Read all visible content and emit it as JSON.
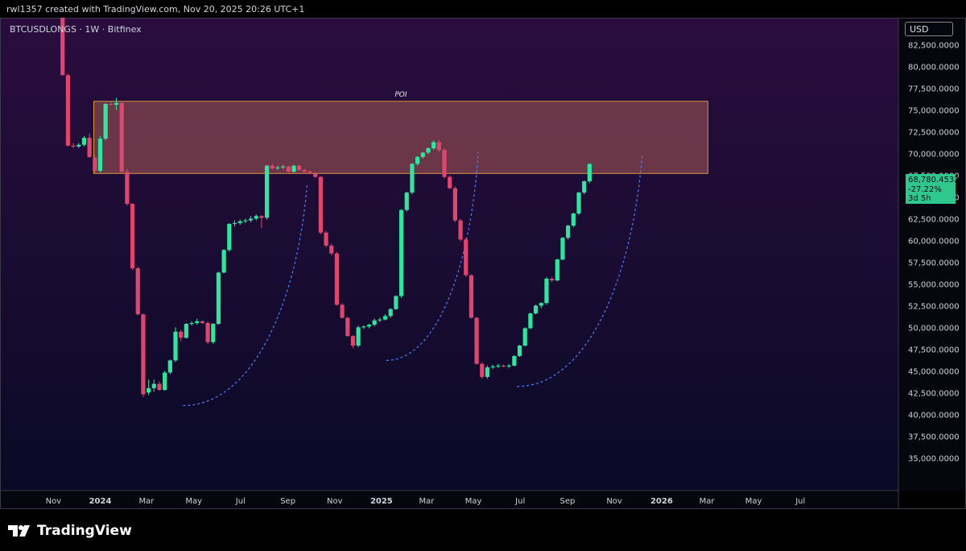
{
  "header": {
    "watermark": "rwl1357 created with TradingView.com, Nov 20, 2025 20:26 UTC+1"
  },
  "symbol": "BTCUSDLONGS · 1W · Bitfinex",
  "currency_button": "USD",
  "price_tag": {
    "price": "68,780.4532",
    "change": "-27.22%",
    "countdown": "3d 5h"
  },
  "footer": {
    "brand": "TradingView"
  },
  "chart_data": {
    "type": "candlestick",
    "y_ticks": [
      35000,
      37500,
      40000,
      42500,
      45000,
      47500,
      50000,
      52500,
      55000,
      57500,
      60000,
      62500,
      65000,
      67500,
      70000,
      72500,
      75000,
      77500,
      80000,
      82500
    ],
    "y_tick_labels": [
      "35,000.0000",
      "37,500.0000",
      "40,000.0000",
      "42,500.0000",
      "45,000.0000",
      "47,500.0000",
      "50,000.0000",
      "52,500.0000",
      "55,000.0000",
      "57,500.0000",
      "60,000.0000",
      "62,500.0000",
      "65,000.0000",
      "67,500.0000",
      "70,000.0000",
      "72,500.0000",
      "75,000.0000",
      "77,500.0000",
      "80,000.0000",
      "82,500.0000"
    ],
    "ylim": [
      32800,
      85800
    ],
    "x_labels": [
      "Nov",
      "2024",
      "Mar",
      "May",
      "Jul",
      "Sep",
      "Nov",
      "2025",
      "Mar",
      "May",
      "Jul",
      "Sep",
      "Nov",
      "2026",
      "Mar",
      "May",
      "Jul"
    ],
    "x_label_weeks": [
      -8.7,
      0,
      8.6,
      17.4,
      26.1,
      34.9,
      43.6,
      52.3,
      60.7,
      69.4,
      78.1,
      86.9,
      95.6,
      104.4,
      112.8,
      121.5,
      130.2
    ],
    "zone": {
      "label": "POI",
      "top": 76000,
      "bottom": 67700,
      "start_week": 0,
      "end_week": 113
    },
    "candles": [
      {
        "o": 87000,
        "h": 87500,
        "l": 79000,
        "c": 79000
      },
      {
        "o": 79000,
        "h": 79200,
        "l": 70800,
        "c": 70900
      },
      {
        "o": 70900,
        "h": 71200,
        "l": 70600,
        "c": 70800
      },
      {
        "o": 70800,
        "h": 71200,
        "l": 70600,
        "c": 71000
      },
      {
        "o": 71000,
        "h": 72000,
        "l": 70800,
        "c": 71800
      },
      {
        "o": 71800,
        "h": 72300,
        "l": 69500,
        "c": 69600
      },
      {
        "o": 69500,
        "h": 69800,
        "l": 67700,
        "c": 68000
      },
      {
        "o": 68000,
        "h": 72000,
        "l": 67800,
        "c": 71700
      },
      {
        "o": 71700,
        "h": 75800,
        "l": 71500,
        "c": 75700
      },
      {
        "o": 75700,
        "h": 75900,
        "l": 75500,
        "c": 75600
      },
      {
        "o": 75600,
        "h": 76400,
        "l": 75000,
        "c": 75800
      },
      {
        "o": 75800,
        "h": 76000,
        "l": 67800,
        "c": 67900
      },
      {
        "o": 67900,
        "h": 68200,
        "l": 64000,
        "c": 64200
      },
      {
        "o": 64200,
        "h": 64300,
        "l": 56600,
        "c": 56800
      },
      {
        "o": 56800,
        "h": 57000,
        "l": 51400,
        "c": 51500
      },
      {
        "o": 51500,
        "h": 51600,
        "l": 42000,
        "c": 42300
      },
      {
        "o": 42500,
        "h": 44000,
        "l": 42200,
        "c": 43000
      },
      {
        "o": 43000,
        "h": 44000,
        "l": 42600,
        "c": 43500
      },
      {
        "o": 43500,
        "h": 43800,
        "l": 42700,
        "c": 42800
      },
      {
        "o": 42800,
        "h": 45000,
        "l": 42700,
        "c": 44800
      },
      {
        "o": 44800,
        "h": 46300,
        "l": 44600,
        "c": 46200
      },
      {
        "o": 46200,
        "h": 50000,
        "l": 46000,
        "c": 49500
      },
      {
        "o": 49500,
        "h": 49700,
        "l": 48400,
        "c": 48800
      },
      {
        "o": 48800,
        "h": 50500,
        "l": 48700,
        "c": 50400
      },
      {
        "o": 50400,
        "h": 50700,
        "l": 50200,
        "c": 50500
      },
      {
        "o": 50500,
        "h": 51000,
        "l": 50300,
        "c": 50700
      },
      {
        "o": 50700,
        "h": 50800,
        "l": 50400,
        "c": 50500
      },
      {
        "o": 50500,
        "h": 50700,
        "l": 48100,
        "c": 48300
      },
      {
        "o": 48300,
        "h": 50500,
        "l": 48100,
        "c": 50400
      },
      {
        "o": 50400,
        "h": 56400,
        "l": 50300,
        "c": 56300
      },
      {
        "o": 56300,
        "h": 59000,
        "l": 56200,
        "c": 58900
      },
      {
        "o": 58900,
        "h": 62000,
        "l": 58700,
        "c": 61900
      },
      {
        "o": 61900,
        "h": 62300,
        "l": 61600,
        "c": 62000
      },
      {
        "o": 62000,
        "h": 62400,
        "l": 61800,
        "c": 62200
      },
      {
        "o": 62200,
        "h": 62500,
        "l": 62000,
        "c": 62300
      },
      {
        "o": 62300,
        "h": 62800,
        "l": 62100,
        "c": 62500
      },
      {
        "o": 62500,
        "h": 63000,
        "l": 62300,
        "c": 62800
      },
      {
        "o": 62800,
        "h": 62900,
        "l": 61400,
        "c": 62600
      },
      {
        "o": 62600,
        "h": 68700,
        "l": 62400,
        "c": 68600
      },
      {
        "o": 68600,
        "h": 68800,
        "l": 68100,
        "c": 68300
      },
      {
        "o": 68300,
        "h": 68600,
        "l": 68100,
        "c": 68400
      },
      {
        "o": 68400,
        "h": 68700,
        "l": 68200,
        "c": 68500
      },
      {
        "o": 68500,
        "h": 68600,
        "l": 67800,
        "c": 67900
      },
      {
        "o": 67900,
        "h": 68700,
        "l": 67800,
        "c": 68600
      },
      {
        "o": 68600,
        "h": 68700,
        "l": 68000,
        "c": 68100
      },
      {
        "o": 68100,
        "h": 68200,
        "l": 67800,
        "c": 67900
      },
      {
        "o": 67900,
        "h": 68100,
        "l": 67600,
        "c": 67700
      },
      {
        "o": 67700,
        "h": 67900,
        "l": 67200,
        "c": 67300
      },
      {
        "o": 67300,
        "h": 67400,
        "l": 60700,
        "c": 60900
      },
      {
        "o": 60900,
        "h": 61100,
        "l": 59200,
        "c": 59400
      },
      {
        "o": 59400,
        "h": 59600,
        "l": 58300,
        "c": 58500
      },
      {
        "o": 58500,
        "h": 58700,
        "l": 52500,
        "c": 52600
      },
      {
        "o": 52600,
        "h": 52800,
        "l": 51000,
        "c": 51100
      },
      {
        "o": 51100,
        "h": 51200,
        "l": 48900,
        "c": 49000
      },
      {
        "o": 49000,
        "h": 49100,
        "l": 47600,
        "c": 47900
      },
      {
        "o": 47900,
        "h": 50200,
        "l": 47700,
        "c": 50000
      },
      {
        "o": 50000,
        "h": 50200,
        "l": 49800,
        "c": 50100
      },
      {
        "o": 50100,
        "h": 50400,
        "l": 49900,
        "c": 50300
      },
      {
        "o": 50300,
        "h": 51000,
        "l": 50100,
        "c": 50800
      },
      {
        "o": 50800,
        "h": 51100,
        "l": 50600,
        "c": 50900
      },
      {
        "o": 50900,
        "h": 51500,
        "l": 50800,
        "c": 51300
      },
      {
        "o": 51300,
        "h": 52200,
        "l": 51100,
        "c": 52100
      },
      {
        "o": 52100,
        "h": 53700,
        "l": 52000,
        "c": 53600
      },
      {
        "o": 53600,
        "h": 63600,
        "l": 53400,
        "c": 63500
      },
      {
        "o": 63500,
        "h": 65600,
        "l": 63300,
        "c": 65500
      },
      {
        "o": 65500,
        "h": 68900,
        "l": 65300,
        "c": 68800
      },
      {
        "o": 68800,
        "h": 69700,
        "l": 68600,
        "c": 69600
      },
      {
        "o": 69600,
        "h": 70200,
        "l": 69400,
        "c": 70100
      },
      {
        "o": 70100,
        "h": 70700,
        "l": 69900,
        "c": 70600
      },
      {
        "o": 70600,
        "h": 71500,
        "l": 70400,
        "c": 71300
      },
      {
        "o": 71300,
        "h": 71600,
        "l": 70200,
        "c": 70400
      },
      {
        "o": 70400,
        "h": 70600,
        "l": 67100,
        "c": 67300
      },
      {
        "o": 67300,
        "h": 67500,
        "l": 65900,
        "c": 66000
      },
      {
        "o": 66000,
        "h": 66200,
        "l": 62100,
        "c": 62300
      },
      {
        "o": 62300,
        "h": 62500,
        "l": 59900,
        "c": 60100
      },
      {
        "o": 60100,
        "h": 60300,
        "l": 55800,
        "c": 56000
      },
      {
        "o": 56000,
        "h": 56100,
        "l": 51000,
        "c": 51100
      },
      {
        "o": 51100,
        "h": 51200,
        "l": 45700,
        "c": 45800
      },
      {
        "o": 45800,
        "h": 46000,
        "l": 44100,
        "c": 44300
      },
      {
        "o": 44300,
        "h": 45600,
        "l": 44100,
        "c": 45400
      },
      {
        "o": 45400,
        "h": 45700,
        "l": 45200,
        "c": 45500
      },
      {
        "o": 45500,
        "h": 45800,
        "l": 45300,
        "c": 45600
      },
      {
        "o": 45600,
        "h": 45700,
        "l": 45400,
        "c": 45500
      },
      {
        "o": 45500,
        "h": 45800,
        "l": 45300,
        "c": 45600
      },
      {
        "o": 45600,
        "h": 46800,
        "l": 45500,
        "c": 46700
      },
      {
        "o": 46700,
        "h": 48000,
        "l": 46600,
        "c": 47900
      },
      {
        "o": 47900,
        "h": 50000,
        "l": 47800,
        "c": 49900
      },
      {
        "o": 49900,
        "h": 51700,
        "l": 49800,
        "c": 51600
      },
      {
        "o": 51600,
        "h": 52600,
        "l": 51500,
        "c": 52500
      },
      {
        "o": 52500,
        "h": 52900,
        "l": 52200,
        "c": 52800
      },
      {
        "o": 52800,
        "h": 55800,
        "l": 52600,
        "c": 55600
      },
      {
        "o": 55600,
        "h": 55800,
        "l": 55200,
        "c": 55400
      },
      {
        "o": 55400,
        "h": 57900,
        "l": 55300,
        "c": 57800
      },
      {
        "o": 57800,
        "h": 60400,
        "l": 57700,
        "c": 60300
      },
      {
        "o": 60300,
        "h": 61800,
        "l": 60100,
        "c": 61700
      },
      {
        "o": 61700,
        "h": 63200,
        "l": 61500,
        "c": 63100
      },
      {
        "o": 63100,
        "h": 65600,
        "l": 62900,
        "c": 65500
      },
      {
        "o": 65500,
        "h": 66900,
        "l": 65300,
        "c": 66800
      },
      {
        "o": 66800,
        "h": 68900,
        "l": 66600,
        "c": 68780
      }
    ],
    "curves": [
      {
        "start_week": 15.4,
        "end_week": 38.5,
        "start": 41000,
        "end": 66600
      },
      {
        "start_week": 53.2,
        "end_week": 70.3,
        "start": 46200,
        "end": 70200
      },
      {
        "start_week": 77.5,
        "end_week": 100.8,
        "start": 43200,
        "end": 70000
      }
    ],
    "colors": {
      "up": "#2ee6a0",
      "down": "#e0456e",
      "bg_top": "#2a0d3e",
      "bg_bottom": "#0a0a26",
      "zone_fill": "#a85a58",
      "zone_border": "#d79540",
      "curve": "#4b80ff",
      "axis_bg": "#06060f"
    }
  }
}
